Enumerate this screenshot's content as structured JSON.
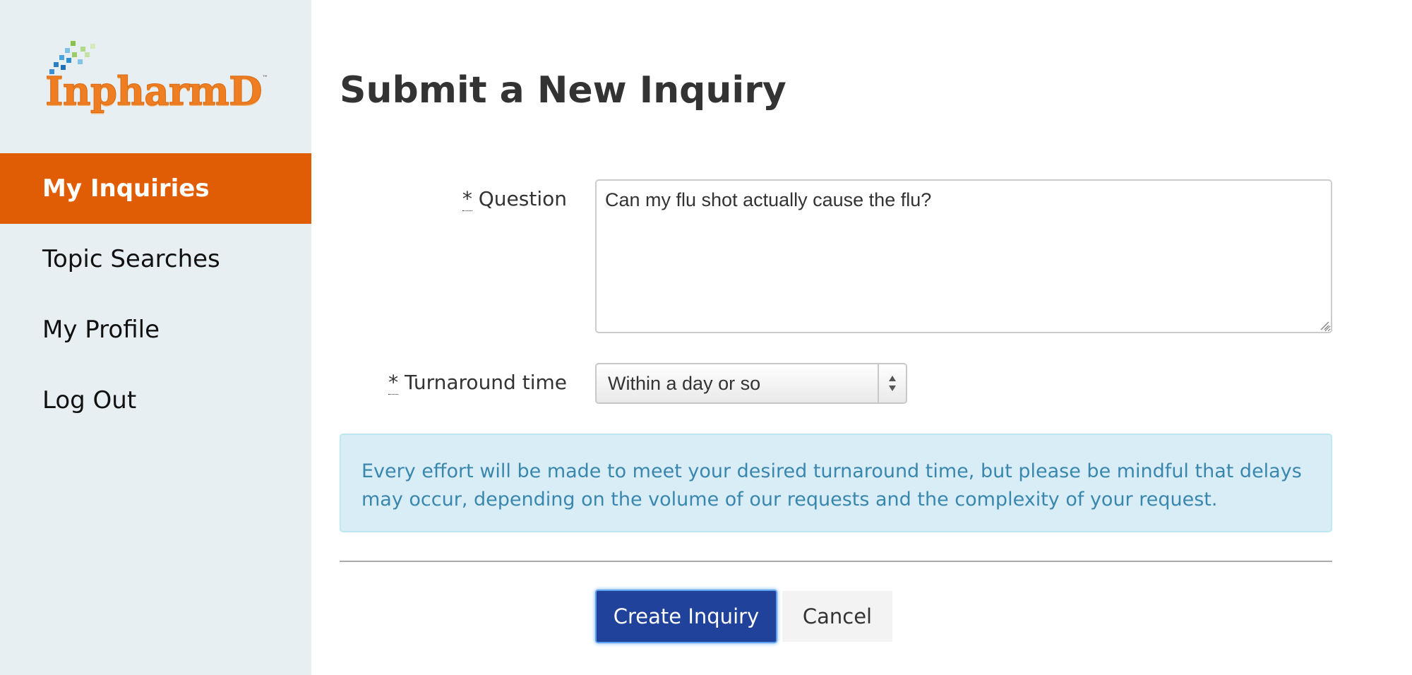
{
  "brand": {
    "name": "InpharmD",
    "trademark": "™",
    "color": "#ef7d22"
  },
  "sidebar": {
    "items": [
      {
        "label": "My Inquiries",
        "active": true
      },
      {
        "label": "Topic Searches",
        "active": false
      },
      {
        "label": "My Profile",
        "active": false
      },
      {
        "label": "Log Out",
        "active": false
      }
    ],
    "active_color": "#e05d05",
    "background": "#e8eff3"
  },
  "main": {
    "title": "Submit a New Inquiry",
    "form": {
      "question": {
        "required_marker": "*",
        "label": "Question",
        "value": "Can my flu shot actually cause the flu?"
      },
      "turnaround": {
        "required_marker": "*",
        "label": "Turnaround time",
        "selected": "Within a day or so"
      },
      "notice": "Every effort will be made to meet your desired turnaround time, but please be mindful that delays may occur, depending on the volume of our requests and the complexity of your request.",
      "actions": {
        "submit_label": "Create Inquiry",
        "cancel_label": "Cancel"
      }
    }
  },
  "icons": {
    "select_arrows": "up-down-arrows-icon",
    "resize_grip": "resize-grip-icon"
  }
}
